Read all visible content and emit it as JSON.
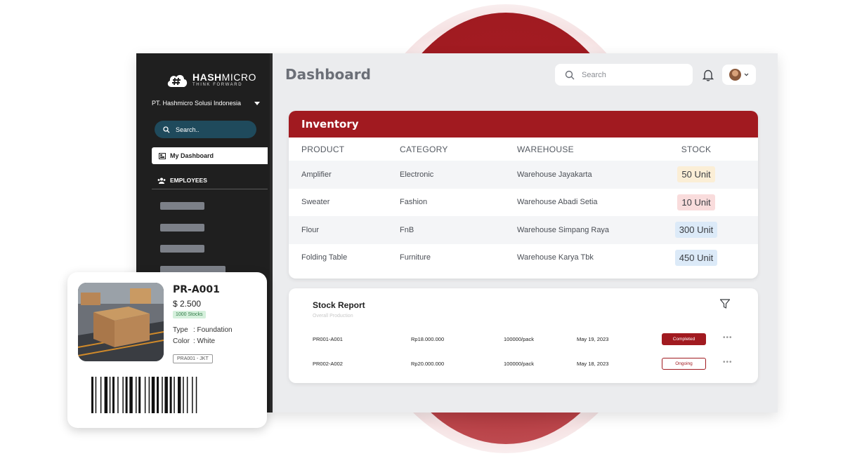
{
  "brand": {
    "name_bold": "HASH",
    "name_light": "MICRO",
    "tagline": "THINK FORWARD"
  },
  "sidebar": {
    "company": "PT. Hashmicro Solusi Indonesia",
    "search_placeholder": "Search..",
    "active_item": "My Dashboard",
    "section_label": "EMPLOYEES"
  },
  "header": {
    "title": "Dashboard",
    "search_placeholder": "Search"
  },
  "inventory": {
    "title": "Inventory",
    "columns": [
      "PRODUCT",
      "CATEGORY",
      "WAREHOUSE",
      "STOCK"
    ],
    "rows": [
      {
        "product": "Amplifier",
        "category": "Electronic",
        "warehouse": "Warehouse Jayakarta",
        "stock": "50 Unit",
        "badge_color": "#fbeed6"
      },
      {
        "product": "Sweater",
        "category": "Fashion",
        "warehouse": "Warehouse Abadi Setia",
        "stock": "10 Unit",
        "badge_color": "#f9dcdc"
      },
      {
        "product": "Flour",
        "category": "FnB",
        "warehouse": "Warehouse Simpang Raya",
        "stock": "300 Unit",
        "badge_color": "#dceaf8"
      },
      {
        "product": "Folding Table",
        "category": "Furniture",
        "warehouse": "Warehouse Karya Tbk",
        "stock": "450 Unit",
        "badge_color": "#dceaf8"
      }
    ]
  },
  "stock_report": {
    "title": "Stock Report",
    "subtitle": "Overall Production",
    "rows": [
      {
        "code": "PR001-A001",
        "amount": "Rp18.000.000",
        "qty": "100000/pack",
        "date": "May 19, 2023",
        "status": "Completed"
      },
      {
        "code": "PR002-A002",
        "amount": "Rp20.000.000",
        "qty": "100000/pack",
        "date": "May 18, 2023",
        "status": "Ongoing"
      }
    ]
  },
  "product_card": {
    "id": "PR-A001",
    "price": "$ 2.500",
    "stock_badge": "1000 Stocks",
    "type_label": "Type",
    "type_value": ": Foundation",
    "color_label": "Color",
    "color_value": ": White",
    "code": "PRA001 - JKT"
  },
  "colors": {
    "brand_red": "#a11a20",
    "sidebar_bg": "#1f1f1f",
    "search_teal": "#1f4a5c"
  }
}
